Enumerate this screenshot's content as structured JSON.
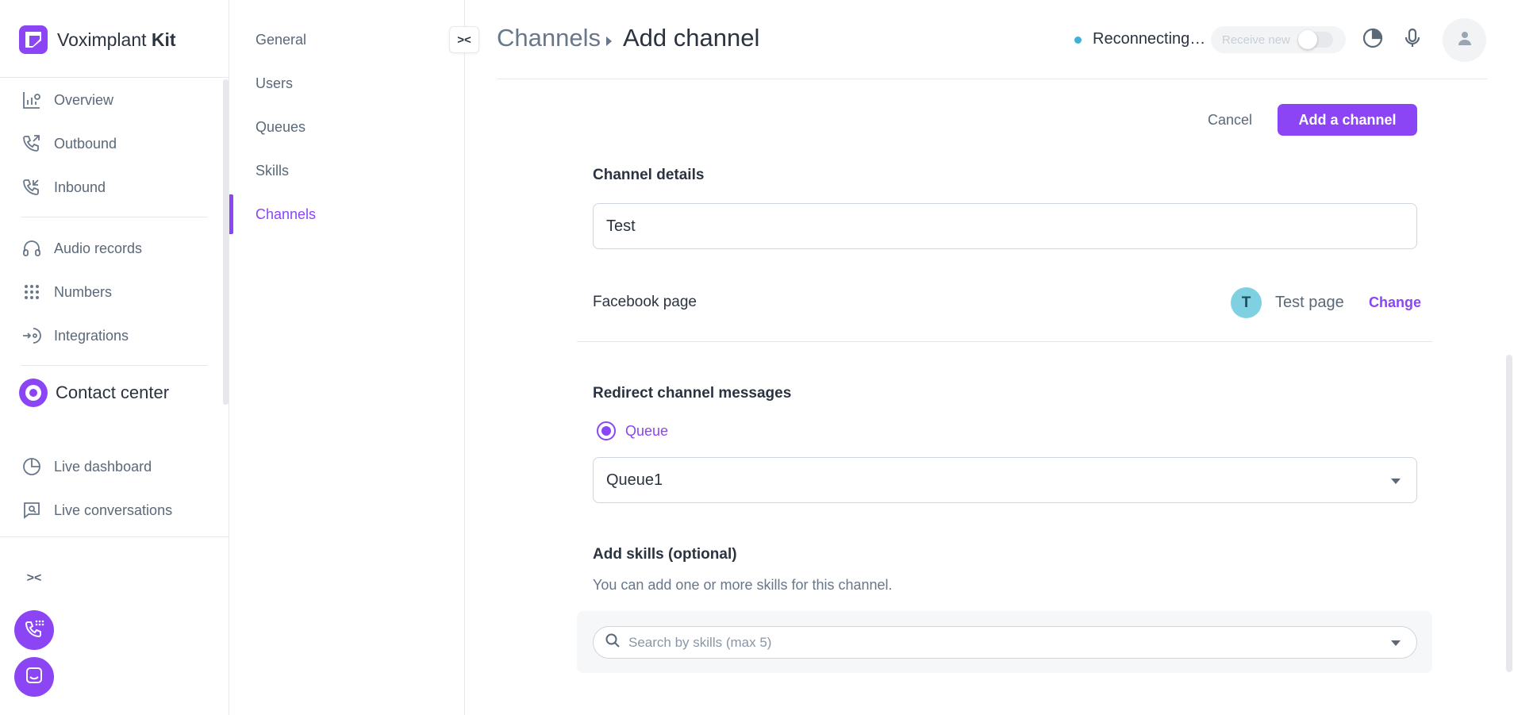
{
  "brand": {
    "name_regular": "Voximplant",
    "name_bold": "Kit"
  },
  "sidebar": {
    "items": [
      {
        "key": "overview",
        "label": "Overview",
        "icon": "chart-bars-icon"
      },
      {
        "key": "outbound",
        "label": "Outbound",
        "icon": "phone-outgoing-icon"
      },
      {
        "key": "inbound",
        "label": "Inbound",
        "icon": "phone-incoming-icon"
      },
      {
        "key": "audio-records",
        "label": "Audio records",
        "icon": "headphones-icon"
      },
      {
        "key": "numbers",
        "label": "Numbers",
        "icon": "keypad-icon"
      },
      {
        "key": "integrations",
        "label": "Integrations",
        "icon": "integrations-icon"
      }
    ],
    "contact_center": "Contact center",
    "cc_items": [
      {
        "key": "live-dashboard",
        "label": "Live dashboard",
        "icon": "pie-chart-icon"
      },
      {
        "key": "live-conversations",
        "label": "Live conversations",
        "icon": "chat-search-icon"
      }
    ],
    "collapse_icon": "collapse-arrows-icon"
  },
  "subnav": {
    "items": [
      {
        "key": "general",
        "label": "General",
        "active": false
      },
      {
        "key": "users",
        "label": "Users",
        "active": false
      },
      {
        "key": "queues",
        "label": "Queues",
        "active": false
      },
      {
        "key": "skills",
        "label": "Skills",
        "active": false
      },
      {
        "key": "channels",
        "label": "Channels",
        "active": true
      }
    ]
  },
  "header": {
    "breadcrumb_root": "Channels",
    "breadcrumb_current": "Add channel",
    "status": "Reconnecting…",
    "toggle_label": "Receive new",
    "toggle_on": false
  },
  "actions": {
    "cancel": "Cancel",
    "submit": "Add a channel"
  },
  "form": {
    "channel_details_title": "Channel details",
    "channel_name_value": "Test",
    "facebook_label": "Facebook page",
    "page_initial": "T",
    "page_name": "Test page",
    "change_label": "Change",
    "redirect_title": "Redirect channel messages",
    "redirect_option": "Queue",
    "queue_selected": "Queue1",
    "skills_title": "Add skills (optional)",
    "skills_hint": "You can add one or more skills for this channel.",
    "skills_placeholder": "Search by skills (max 5)"
  },
  "colors": {
    "accent": "#8b45f5",
    "status_dot": "#3fb0d8",
    "page_badge": "#7fd0e0",
    "text_primary": "#2b3340",
    "text_secondary": "#5a6878"
  }
}
